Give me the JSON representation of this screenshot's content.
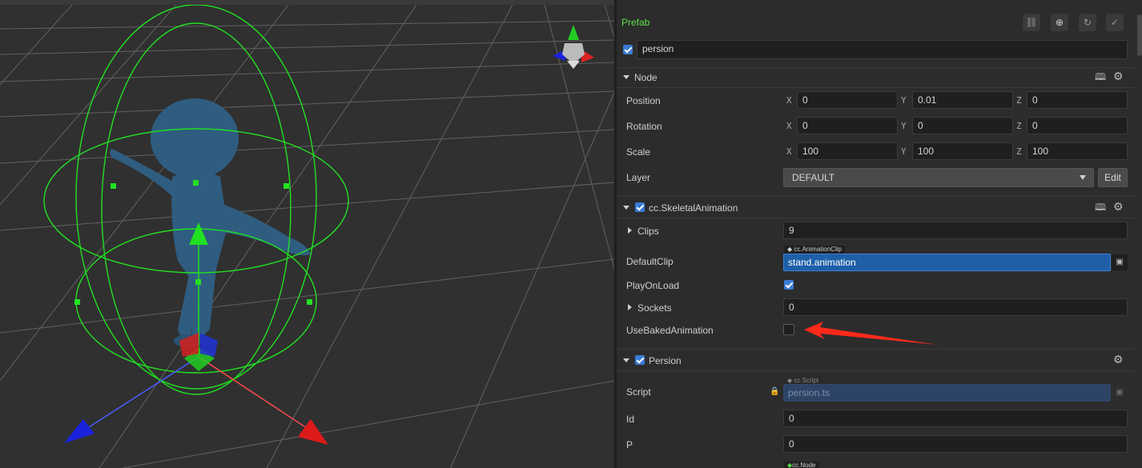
{
  "inspector": {
    "title": "Prefab",
    "node_name": "persion",
    "node_section": {
      "label": "Node",
      "position": {
        "label": "Position",
        "x": "0",
        "y": "0.01",
        "z": "0"
      },
      "rotation": {
        "label": "Rotation",
        "x": "0",
        "y": "0",
        "z": "0"
      },
      "scale": {
        "label": "Scale",
        "x": "100",
        "y": "100",
        "z": "100"
      },
      "layer": {
        "label": "Layer",
        "value": "DEFAULT",
        "edit_label": "Edit"
      },
      "axis_x": "X",
      "axis_y": "Y",
      "axis_z": "Z"
    },
    "skeletal": {
      "label": "cc.SkeletalAnimation",
      "clips": {
        "label": "Clips",
        "value": "9"
      },
      "default_clip": {
        "label": "DefaultClip",
        "type_tag": "cc.AnimationClip",
        "value": "stand.animation"
      },
      "play_on_load": {
        "label": "PlayOnLoad",
        "checked": true
      },
      "sockets": {
        "label": "Sockets",
        "value": "0"
      },
      "use_baked": {
        "label": "UseBakedAnimation",
        "checked": false
      }
    },
    "persion": {
      "label": "Persion",
      "script": {
        "label": "Script",
        "type_tag": "cc.Script",
        "value": "persion.ts"
      },
      "id": {
        "label": "Id",
        "value": "0"
      },
      "p": {
        "label": "P",
        "value": "0"
      },
      "node_tag": "cc.Node"
    }
  },
  "colors": {
    "accent_green": "#4fd63f",
    "selection_blue": "#1e5fa8",
    "annotation_red": "#ff2a1a",
    "gizmo_green": "#22e022"
  },
  "icons": [
    "link-icon",
    "locate-icon",
    "refresh-icon",
    "check-circle-icon",
    "book-icon",
    "gear-icon",
    "lock-icon",
    "asset-picker-icon",
    "dropdown-arrow-icon"
  ]
}
